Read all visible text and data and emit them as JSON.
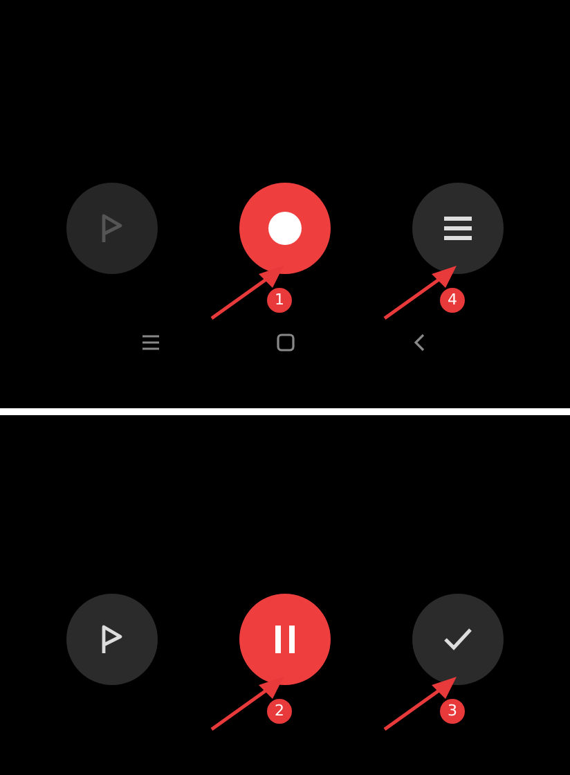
{
  "panels": [
    {
      "buttons": [
        {
          "kind": "flag",
          "disabled": true
        },
        {
          "kind": "record",
          "disabled": false,
          "annotation": "1"
        },
        {
          "kind": "menu",
          "disabled": false,
          "annotation": "4"
        }
      ],
      "nav_bar": [
        {
          "kind": "menu"
        },
        {
          "kind": "home"
        },
        {
          "kind": "back"
        }
      ]
    },
    {
      "buttons": [
        {
          "kind": "flag",
          "disabled": false
        },
        {
          "kind": "pause",
          "disabled": false,
          "annotation": "2"
        },
        {
          "kind": "done",
          "disabled": false,
          "annotation": "3"
        }
      ]
    }
  ]
}
